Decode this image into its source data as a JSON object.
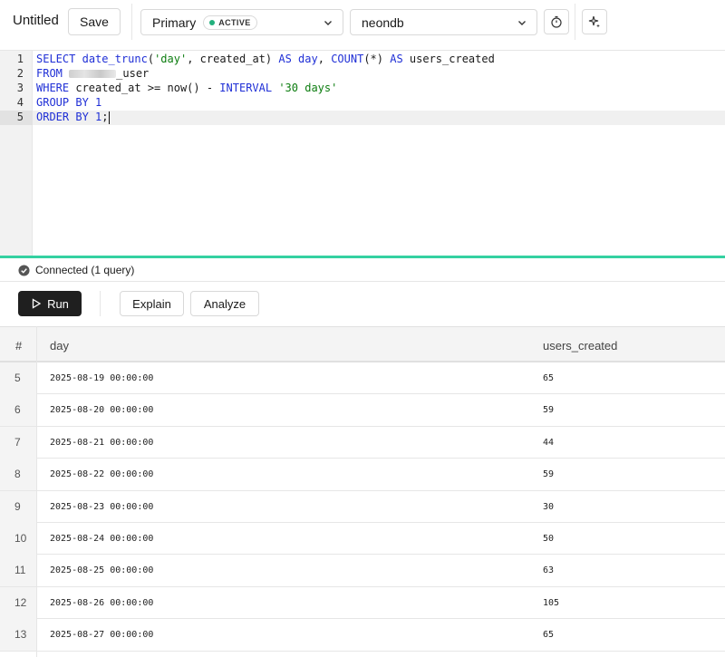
{
  "toolbar": {
    "title": "Untitled",
    "save_label": "Save",
    "branch": {
      "label": "Primary",
      "status": "ACTIVE",
      "status_color": "#22b07d"
    },
    "database": "neondb"
  },
  "editor": {
    "line_numbers": [
      "1",
      "2",
      "3",
      "4",
      "5"
    ],
    "lines": {
      "l1": {
        "kw1": "SELECT",
        "fn1": "date_trunc",
        "p1": "(",
        "s1": "'day'",
        "p2": ", created_at) ",
        "kw2": "AS",
        "p3": " ",
        "kw3": "day",
        "p4": ", ",
        "fn2": "COUNT",
        "p5": "(*) ",
        "kw4": "AS",
        "p6": " users_created"
      },
      "l2": {
        "kw1": "FROM",
        "p1": " ",
        "p2": "_user"
      },
      "l3": {
        "kw1": "WHERE",
        "p1": " created_at >= now() - ",
        "kw2": "INTERVAL",
        "p2": " ",
        "s1": "'30 days'"
      },
      "l4": {
        "kw1": "GROUP BY",
        "p1": " ",
        "n1": "1"
      },
      "l5": {
        "kw1": "ORDER BY",
        "p1": " ",
        "n1": "1",
        "p2": ";"
      }
    }
  },
  "status": {
    "text": "Connected (1 query)"
  },
  "actions": {
    "run": "Run",
    "explain": "Explain",
    "analyze": "Analyze"
  },
  "results": {
    "columns": [
      "#",
      "day",
      "users_created"
    ],
    "rows": [
      {
        "idx": "5",
        "day": "2025-08-19 00:00:00",
        "count": "65"
      },
      {
        "idx": "6",
        "day": "2025-08-20 00:00:00",
        "count": "59"
      },
      {
        "idx": "7",
        "day": "2025-08-21 00:00:00",
        "count": "44"
      },
      {
        "idx": "8",
        "day": "2025-08-22 00:00:00",
        "count": "59"
      },
      {
        "idx": "9",
        "day": "2025-08-23 00:00:00",
        "count": "30"
      },
      {
        "idx": "10",
        "day": "2025-08-24 00:00:00",
        "count": "50"
      },
      {
        "idx": "11",
        "day": "2025-08-25 00:00:00",
        "count": "63"
      },
      {
        "idx": "12",
        "day": "2025-08-26 00:00:00",
        "count": "105"
      },
      {
        "idx": "13",
        "day": "2025-08-27 00:00:00",
        "count": "65"
      }
    ]
  }
}
